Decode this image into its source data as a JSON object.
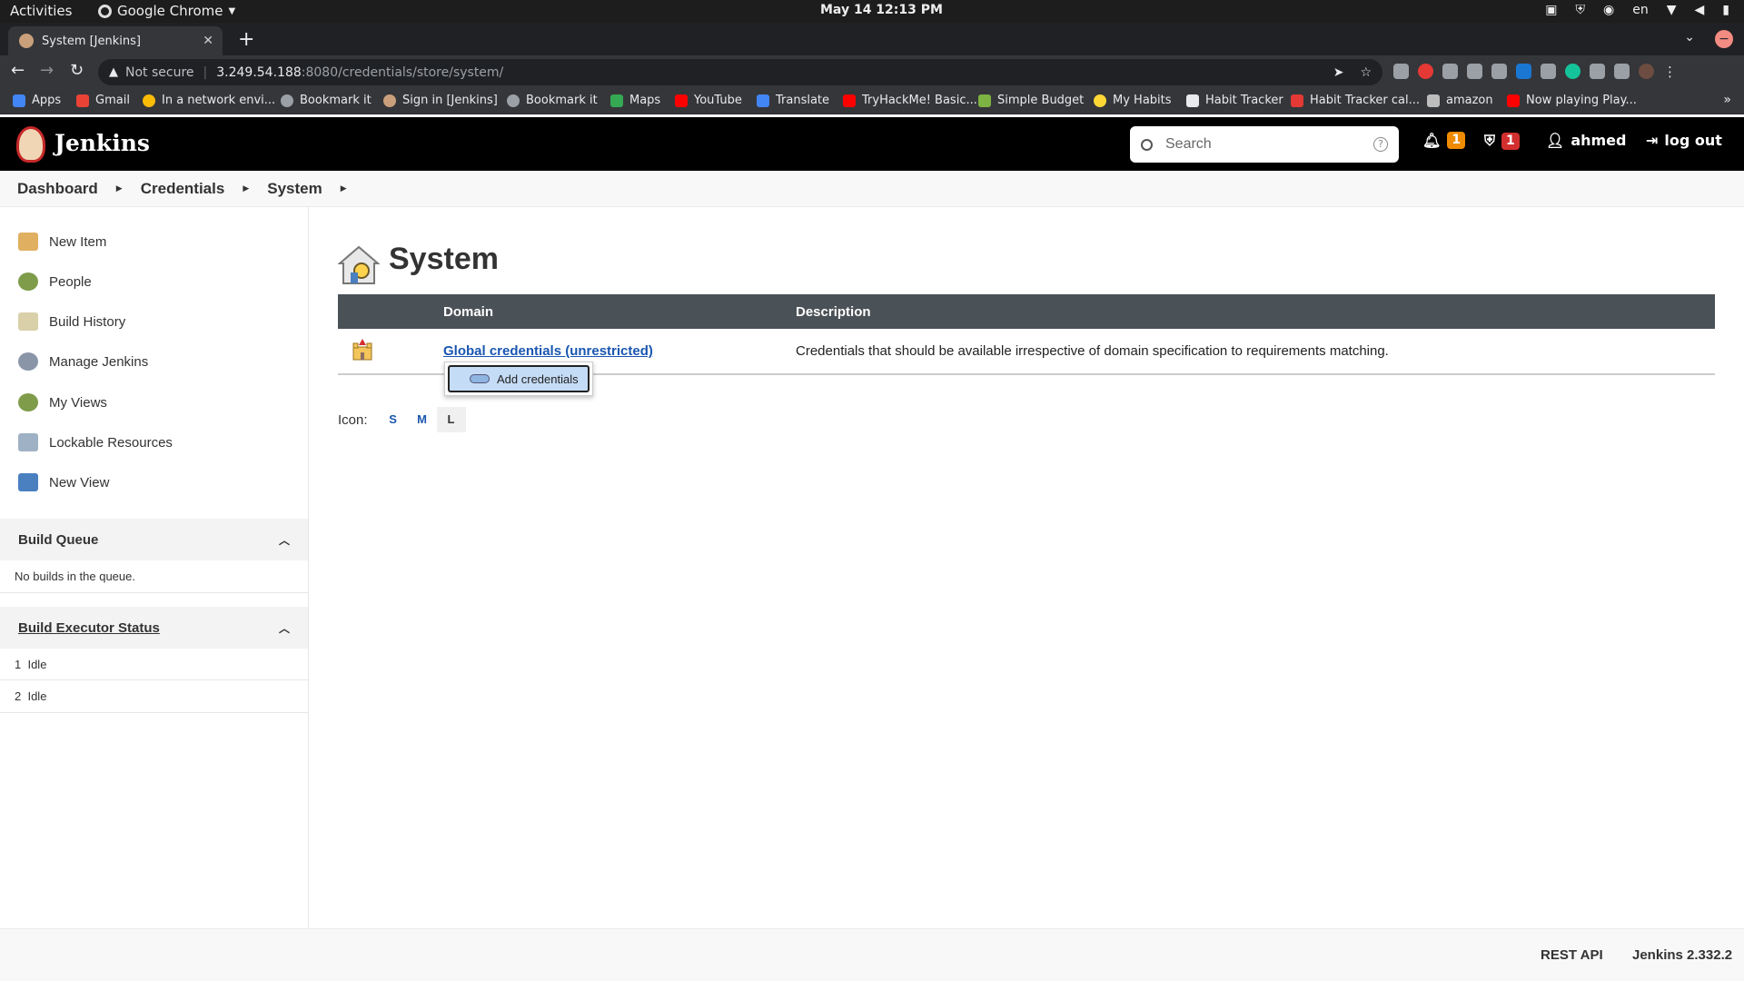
{
  "gnome": {
    "activities": "Activities",
    "app_name": "Google Chrome",
    "clock": "May 14  12:13 PM",
    "lang": "en"
  },
  "browser": {
    "tab_title": "System [Jenkins]",
    "not_secure": "Not secure",
    "url_host": "3.249.54.188",
    "url_path": ":8080/credentials/store/system/",
    "bookmarks": [
      "Apps",
      "Gmail",
      "In a network envi...",
      "Bookmark it",
      "Sign in [Jenkins]",
      "Bookmark it",
      "Maps",
      "YouTube",
      "Translate",
      "TryHackMe! Basic...",
      "Simple Budget",
      "My Habits",
      "Habit Tracker",
      "Habit Tracker cal...",
      "amazon",
      "Now playing Play..."
    ]
  },
  "header": {
    "title": "Jenkins",
    "search_placeholder": "Search",
    "notifications_count": "1",
    "security_count": "1",
    "user": "ahmed",
    "logout": "log out"
  },
  "breadcrumb": [
    "Dashboard",
    "Credentials",
    "System"
  ],
  "sidebar": {
    "tasks": [
      "New Item",
      "People",
      "Build History",
      "Manage Jenkins",
      "My Views",
      "Lockable Resources",
      "New View"
    ],
    "build_queue": {
      "title": "Build Queue",
      "empty": "No builds in the queue."
    },
    "executors": {
      "title": "Build Executor Status",
      "rows": [
        {
          "num": "1",
          "status": "Idle"
        },
        {
          "num": "2",
          "status": "Idle"
        }
      ]
    }
  },
  "main": {
    "title": "System",
    "columns": [
      "Domain",
      "Description"
    ],
    "rows": [
      {
        "domain": "Global credentials (unrestricted)",
        "description": "Credentials that should be available irrespective of domain specification to requirements matching."
      }
    ],
    "context_menu": [
      "Add credentials"
    ],
    "icon_label": "Icon:",
    "icon_sizes": [
      "S",
      "M",
      "L"
    ],
    "icon_size_selected": "L"
  },
  "footer": {
    "rest_api": "REST API",
    "version": "Jenkins 2.332.2"
  }
}
